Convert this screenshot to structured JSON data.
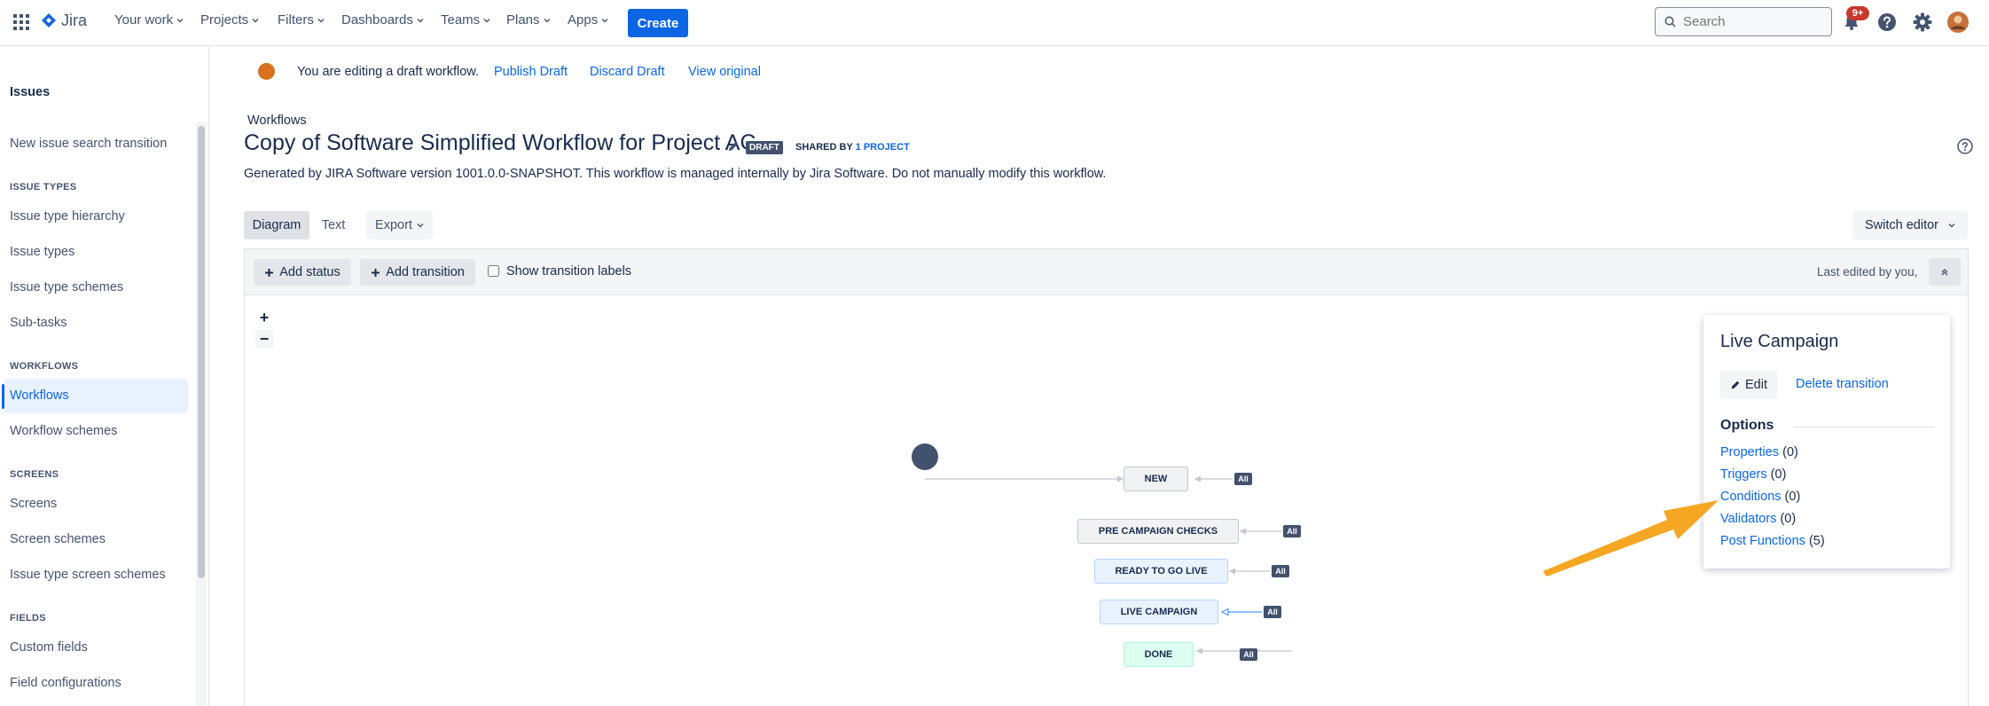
{
  "app": {
    "name": "Jira"
  },
  "topnav": {
    "items": [
      "Your work",
      "Projects",
      "Filters",
      "Dashboards",
      "Teams",
      "Plans",
      "Apps"
    ],
    "create_label": "Create",
    "search_placeholder": "Search",
    "notification_count": "9+"
  },
  "sidebar": {
    "title": "Issues",
    "top_item": "New issue search transition",
    "sections": [
      {
        "heading": "ISSUE TYPES",
        "items": [
          "Issue type hierarchy",
          "Issue types",
          "Issue type schemes",
          "Sub-tasks"
        ]
      },
      {
        "heading": "WORKFLOWS",
        "items": [
          "Workflows",
          "Workflow schemes"
        ]
      },
      {
        "heading": "SCREENS",
        "items": [
          "Screens",
          "Screen schemes",
          "Issue type screen schemes"
        ]
      },
      {
        "heading": "FIELDS",
        "items": [
          "Custom fields",
          "Field configurations"
        ]
      }
    ],
    "active_item": "Workflows"
  },
  "banner": {
    "text": "You are editing a draft workflow.",
    "publish_label": "Publish Draft",
    "discard_label": "Discard Draft",
    "view_original_label": "View original"
  },
  "workflow": {
    "breadcrumb": "Workflows",
    "title": "Copy of Software Simplified Workflow for Project AC",
    "draft_badge": "DRAFT",
    "shared_by_label": "SHARED BY",
    "shared_by_link": "1 PROJECT",
    "description": "Generated by JIRA Software version 1001.0.0-SNAPSHOT. This workflow is managed internally by Jira Software. Do not manually modify this workflow."
  },
  "tabs": {
    "diagram": "Diagram",
    "text": "Text",
    "export": "Export",
    "switch_editor": "Switch editor"
  },
  "toolbar": {
    "add_status": "Add status",
    "add_transition": "Add transition",
    "show_labels": "Show transition labels",
    "last_edited": "Last edited by you,"
  },
  "zoom": {
    "in": "+",
    "out": "−"
  },
  "diagram": {
    "statuses": [
      "NEW",
      "PRE CAMPAIGN CHECKS",
      "READY TO GO LIVE",
      "LIVE CAMPAIGN",
      "DONE"
    ],
    "all_label": "All"
  },
  "panel": {
    "title": "Live Campaign",
    "edit_label": "Edit",
    "delete_label": "Delete transition",
    "options_heading": "Options",
    "options": [
      {
        "label": "Properties",
        "count": "(0)"
      },
      {
        "label": "Triggers",
        "count": "(0)"
      },
      {
        "label": "Conditions",
        "count": "(0)"
      },
      {
        "label": "Validators",
        "count": "(0)"
      },
      {
        "label": "Post Functions",
        "count": "(5)"
      }
    ]
  },
  "colors": {
    "brand": "#0c66e4",
    "draft_dot": "#d9721e",
    "annotation_arrow": "#f5a623",
    "badge_red": "#c9372c"
  }
}
